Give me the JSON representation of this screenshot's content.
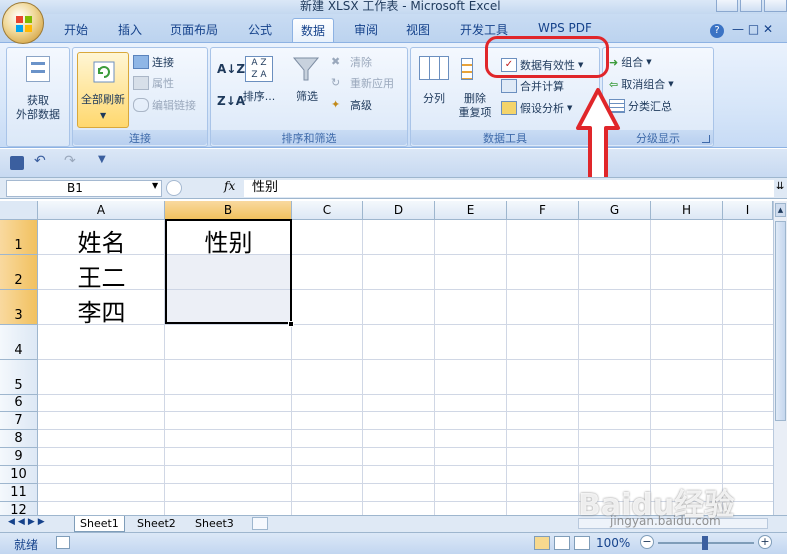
{
  "window": {
    "title": "新建 XLSX 工作表 - Microsoft Excel"
  },
  "ribbon": {
    "tabs": [
      {
        "label": "开始"
      },
      {
        "label": "插入"
      },
      {
        "label": "页面布局"
      },
      {
        "label": "公式"
      },
      {
        "label": "数据"
      },
      {
        "label": "审阅"
      },
      {
        "label": "视图"
      },
      {
        "label": "开发工具"
      },
      {
        "label": "WPS PDF"
      }
    ],
    "active_tab": "数据",
    "groups": {
      "external": {
        "get_external": "获取",
        "get_external2": "外部数据"
      },
      "connections": {
        "label": "连接",
        "refresh_all": "全部刷新",
        "connect": "连接",
        "properties": "属性",
        "edit_links": "编辑链接"
      },
      "sort_filter": {
        "label": "排序和筛选",
        "sort": "排序...",
        "filter": "筛选",
        "clear": "清除",
        "reapply": "重新应用",
        "advanced": "高级"
      },
      "data_tools": {
        "label": "数据工具",
        "text_to_columns": "分列",
        "remove_dup": "删除",
        "remove_dup2": "重复项",
        "validation": "数据有效性",
        "consolidate": "合并计算",
        "what_if": "假设分析"
      },
      "outline": {
        "label": "分级显示",
        "group": "组合",
        "ungroup": "取消组合",
        "subtotal": "分类汇总"
      }
    }
  },
  "formula_bar": {
    "name_box": "B1",
    "fx": "fx",
    "value": "性别"
  },
  "grid": {
    "columns": [
      "A",
      "B",
      "C",
      "D",
      "E",
      "F",
      "G",
      "H",
      "I"
    ],
    "rows": [
      "1",
      "2",
      "3",
      "4",
      "5",
      "6",
      "7",
      "8",
      "9",
      "10",
      "11",
      "12"
    ],
    "cells": {
      "A1": "姓名",
      "B1": "性别",
      "A2": "王二",
      "A3": "李四"
    }
  },
  "sheets": [
    "Sheet1",
    "Sheet2",
    "Sheet3"
  ],
  "status": {
    "ready": "就绪",
    "zoom": "100%"
  },
  "watermark": {
    "text": "Baidu经验",
    "url": "jingyan.baidu.com"
  }
}
